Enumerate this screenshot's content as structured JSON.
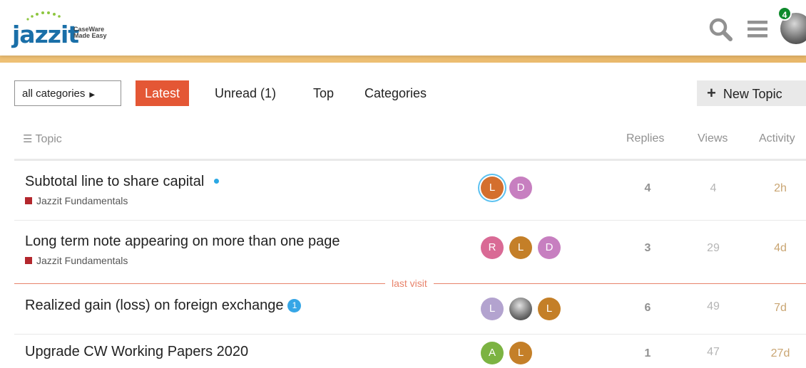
{
  "header": {
    "logo_word": "jazzit",
    "logo_tag_line1": "CaseWare",
    "logo_tag_line2": "Made Easy",
    "notification_count": "4",
    "icons": [
      "search-icon",
      "hamburger-menu-icon",
      "user-avatar"
    ]
  },
  "nav": {
    "category_dropdown": "all categories",
    "tabs": [
      {
        "label": "Latest",
        "active": true
      },
      {
        "label": "Unread (1)",
        "active": false
      },
      {
        "label": "Top",
        "active": false
      },
      {
        "label": "Categories",
        "active": false
      }
    ],
    "new_topic": "New Topic"
  },
  "table": {
    "headers": {
      "topic": "Topic",
      "replies": "Replies",
      "views": "Views",
      "activity": "Activity"
    },
    "rows": [
      {
        "title": "Subtotal line to share capital",
        "category": "Jazzit Fundamentals",
        "unread_dot": true,
        "posters": [
          {
            "letter": "L",
            "color": "#d46f2e"
          },
          {
            "letter": "D",
            "color": "#c77fc0"
          }
        ],
        "replies": "4",
        "views": "4",
        "activity": "2h"
      },
      {
        "title": "Long term note appearing on more than one page",
        "category": "Jazzit Fundamentals",
        "posters": [
          {
            "letter": "R",
            "color": "#d96a95"
          },
          {
            "letter": "L",
            "color": "#c47f28"
          },
          {
            "letter": "D",
            "color": "#c77fc0"
          }
        ],
        "replies": "3",
        "views": "29",
        "activity": "4d"
      },
      {
        "title": "Realized gain (loss) on foreign exchange",
        "new_count": "1",
        "posters": [
          {
            "letter": "L",
            "color": "#b3a3cf"
          },
          {
            "letter": "",
            "color": "photo"
          },
          {
            "letter": "L",
            "color": "#c47f28"
          }
        ],
        "replies": "6",
        "views": "49",
        "activity": "7d"
      },
      {
        "title": "Upgrade CW Working Papers 2020",
        "posters": [
          {
            "letter": "A",
            "color": "#7cb342"
          },
          {
            "letter": "L",
            "color": "#c47f28"
          }
        ],
        "replies": "1",
        "views": "47",
        "activity": "27d"
      }
    ]
  },
  "last_visit_label": "last visit",
  "colors": {
    "accent": "#e45735",
    "category": "#b3272d",
    "badge": "#0e8a2c",
    "unread": "#2aa8e4"
  }
}
